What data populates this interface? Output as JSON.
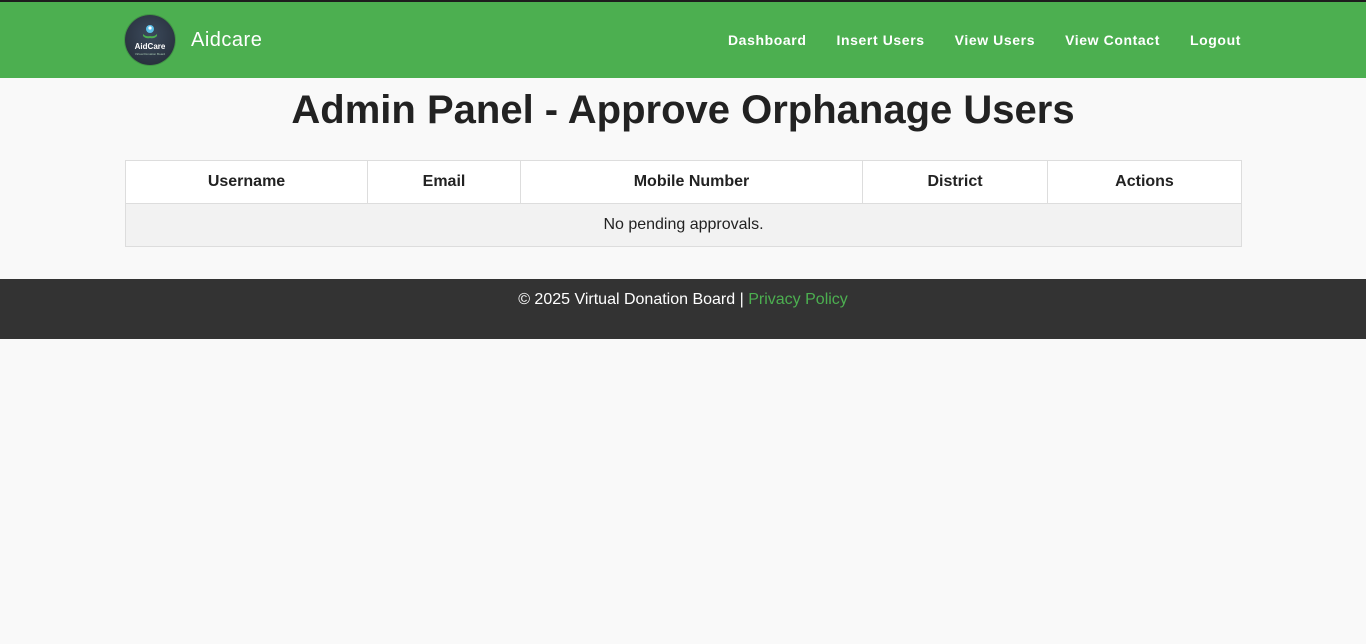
{
  "header": {
    "logo_text": "AidCare",
    "logo_subtext": "Virtual Donation Board",
    "brand_name": "Aidcare",
    "nav": [
      {
        "label": "Dashboard"
      },
      {
        "label": "Insert Users"
      },
      {
        "label": "View Users"
      },
      {
        "label": "View Contact"
      },
      {
        "label": "Logout"
      }
    ],
    "accent_color": "#4caf50"
  },
  "main": {
    "title": "Admin Panel - Approve Orphanage Users",
    "table": {
      "columns": [
        "Username",
        "Email",
        "Mobile Number",
        "District",
        "Actions"
      ],
      "empty_message": "No pending approvals."
    }
  },
  "footer": {
    "copyright": "© 2025 Virtual Donation Board |",
    "link_label": "Privacy Policy",
    "link_color": "#4caf50"
  }
}
